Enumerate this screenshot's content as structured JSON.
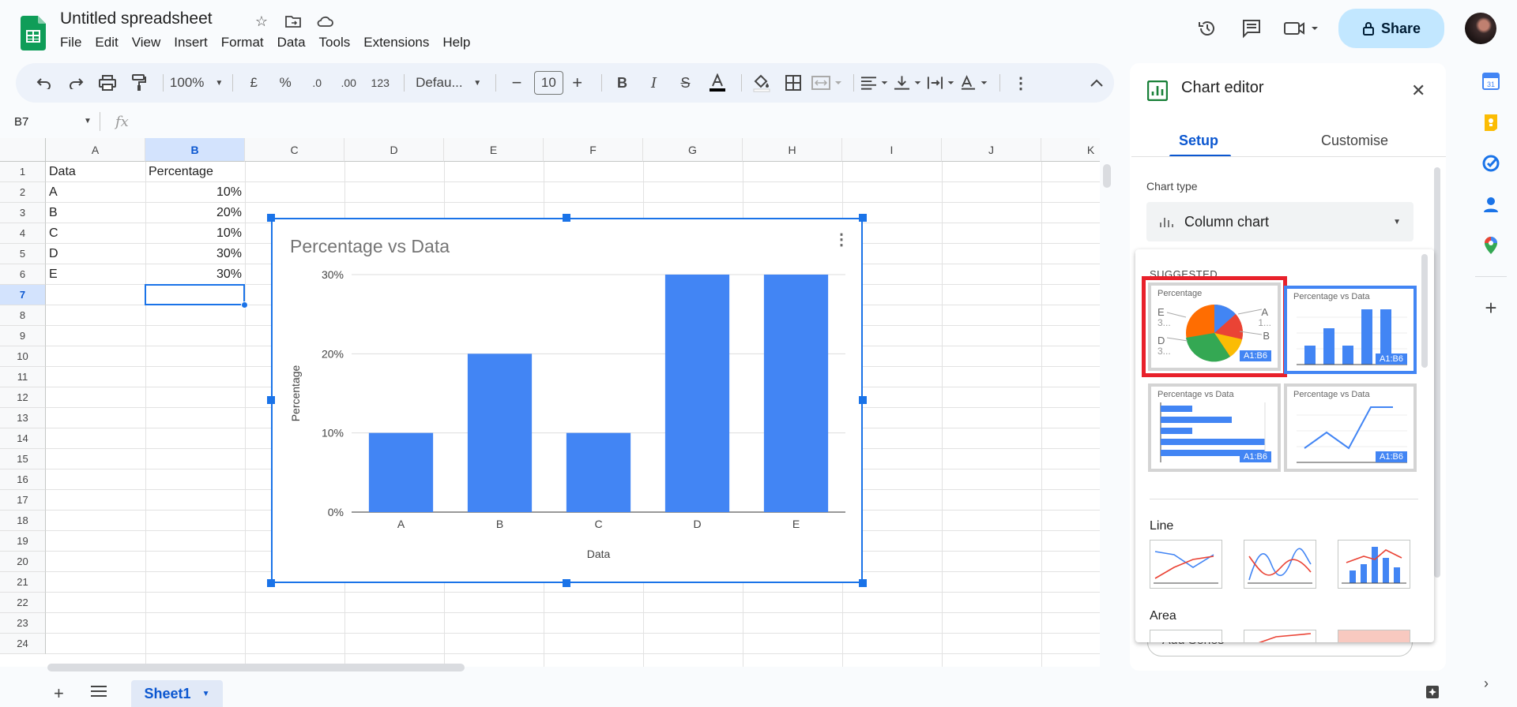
{
  "doc": {
    "title": "Untitled spreadsheet"
  },
  "menu": [
    "File",
    "Edit",
    "View",
    "Insert",
    "Format",
    "Data",
    "Tools",
    "Extensions",
    "Help"
  ],
  "share_label": "Share",
  "toolbar": {
    "zoom": "100%",
    "currency": "£",
    "percent": "%",
    "dec_less": ".0",
    "dec_more": ".00",
    "num_format": "123",
    "font": "Defau...",
    "font_size": "10"
  },
  "namebox": "B7",
  "fx": "fx",
  "columns": [
    "A",
    "B",
    "C",
    "D",
    "E",
    "F",
    "G",
    "H",
    "I",
    "J",
    "K"
  ],
  "rows": [
    "1",
    "2",
    "3",
    "4",
    "5",
    "6",
    "7",
    "8",
    "9",
    "10",
    "11",
    "12",
    "13",
    "14",
    "15",
    "16",
    "17",
    "18",
    "19",
    "20",
    "21",
    "22",
    "23",
    "24"
  ],
  "cells": {
    "A1": "Data",
    "B1": "Percentage",
    "A2": "A",
    "B2": "10%",
    "A3": "B",
    "B3": "20%",
    "A4": "C",
    "B4": "10%",
    "A5": "D",
    "B5": "30%",
    "A6": "E",
    "B6": "30%"
  },
  "chart_data": {
    "type": "bar",
    "title": "Percentage vs Data",
    "xlabel": "Data",
    "ylabel": "Percentage",
    "categories": [
      "A",
      "B",
      "C",
      "D",
      "E"
    ],
    "values": [
      10,
      20,
      10,
      30,
      30
    ],
    "yticks": [
      "0%",
      "10%",
      "20%",
      "30%"
    ],
    "ylim": [
      0,
      30
    ],
    "color": "#4285f4",
    "grid": true
  },
  "sheet_tab": "Sheet1",
  "editor": {
    "title": "Chart editor",
    "tab_setup": "Setup",
    "tab_customise": "Customise",
    "chart_type_label": "Chart type",
    "chart_type_value": "Column chart",
    "suggested_label": "SUGGESTED",
    "thumbs": [
      {
        "title": "Percentage",
        "badge": "A1:B6"
      },
      {
        "title": "Percentage vs Data",
        "badge": "A1:B6"
      },
      {
        "title": "Percentage vs Data",
        "badge": "A1:B6"
      },
      {
        "title": "Percentage vs Data",
        "badge": "A1:B6"
      }
    ],
    "pie_labels": {
      "e": "E",
      "e_val": "3...",
      "d": "D",
      "d_val": "3...",
      "a": "A",
      "a_val": "1...",
      "b": "B"
    },
    "line_label": "Line",
    "area_label": "Area",
    "add_series": "Add Series"
  },
  "colors": {
    "accent": "#1a73e8",
    "bar": "#4285f4",
    "highlight": "#e8212b"
  }
}
